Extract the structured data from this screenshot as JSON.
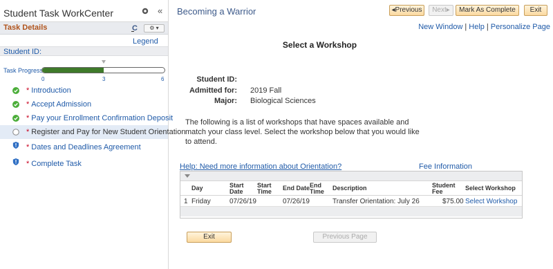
{
  "left_panel": {
    "title": "Student Task WorkCenter",
    "collapse_glyph": "«",
    "task_details": "Task Details",
    "refresh_glyph": "C",
    "options_glyph": "⚙ ▾",
    "legend": "Legend",
    "student_id_label": "Student ID:",
    "task_progress": {
      "label": "Task Progress",
      "value": 3,
      "max": 6,
      "ticks": [
        "0",
        "3",
        "6"
      ]
    },
    "steps": [
      {
        "label": "Introduction",
        "status": "complete",
        "icon": "check-circle-icon"
      },
      {
        "label": "Accept Admission",
        "status": "complete",
        "icon": "check-circle-icon"
      },
      {
        "label": "Pay your Enrollment Confirmation Deposit",
        "status": "complete",
        "icon": "check-circle-icon"
      },
      {
        "label": "Register and Pay for New Student Orientation",
        "status": "current",
        "icon": "empty-circle-icon"
      },
      {
        "label": "Dates and Deadlines Agreement",
        "status": "pending",
        "icon": "info-shield-icon"
      },
      {
        "label": "Complete Task",
        "status": "pending",
        "icon": "info-shield-icon"
      }
    ],
    "required_mark": "*"
  },
  "right_panel": {
    "title": "Becoming a Warrior",
    "buttons": {
      "previous": "◂Previous",
      "next": "Next▸",
      "mark_complete": "Mark As Complete",
      "exit": "Exit"
    },
    "links": {
      "new_window": "New Window",
      "help": "Help",
      "personalize": "Personalize Page"
    },
    "section_title": "Select a Workshop",
    "fields": {
      "student_id_label": "Student ID:",
      "student_id_value": "",
      "admitted_label": "Admitted for:",
      "admitted_value": "2019 Fall",
      "major_label": "Major:",
      "major_value": "Biological Sciences"
    },
    "description": "The following is a list of workshops that have spaces available and match your class level. Select the workshop below that you would like to attend.",
    "help_link": "Help: Need more information about Orientation?",
    "fee_info": "Fee Information",
    "grid": {
      "headers": {
        "day": "Day",
        "start_date": "Start Date",
        "start_time": "Start Time",
        "end_date": "End Date",
        "end_time": "End Time",
        "description": "Description",
        "student_fee": "Student Fee",
        "select": "Select Workshop"
      },
      "rows": [
        {
          "num": "1",
          "day": "Friday",
          "start_date": "07/26/19",
          "start_time": "",
          "end_date": "07/26/19",
          "end_time": "",
          "description": "Transfer Orientation: July 26",
          "fee": "$75.00",
          "select": "Select Workshop"
        }
      ]
    },
    "bottom_buttons": {
      "exit": "Exit",
      "previous_page": "Previous Page"
    }
  },
  "colors": {
    "link": "#1f5aa8",
    "task_details": "#b0531b",
    "progress_fill": "#3f7a2a",
    "required": "#c8001e",
    "button_orange": "#fbd9a0",
    "complete_green": "#4cae3a",
    "info_blue": "#2f6fc4"
  }
}
